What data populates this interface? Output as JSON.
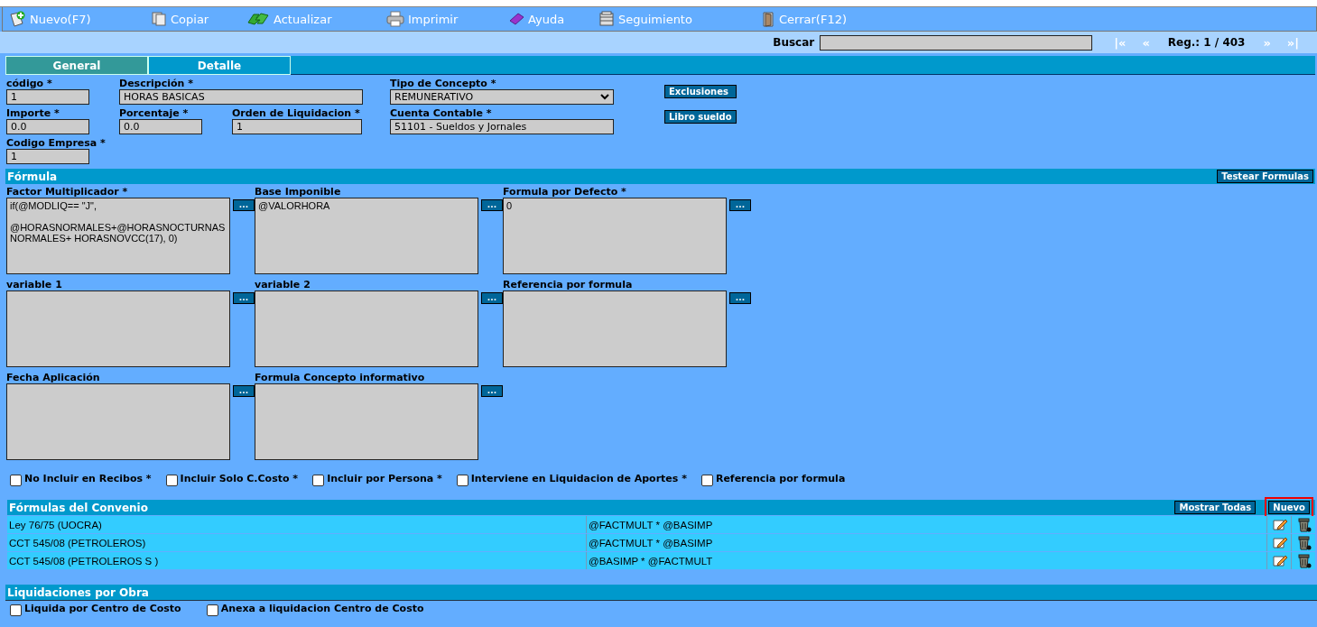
{
  "toolbar": [
    {
      "label": "Nuevo(F7)"
    },
    {
      "label": "Copiar"
    },
    {
      "label": "Actualizar"
    },
    {
      "label": "Imprimir"
    },
    {
      "label": "Ayuda"
    },
    {
      "label": "Seguimiento"
    },
    {
      "label": "Cerrar(F12)"
    }
  ],
  "search": {
    "label": "Buscar",
    "first": "|«",
    "prev": "«",
    "record": "Reg.: 1 / 403",
    "next": "»",
    "last": "»|"
  },
  "tabs": [
    {
      "label": "General",
      "selected": true
    },
    {
      "label": "Detalle",
      "selected": false
    }
  ],
  "field_rows": [
    [
      {
        "label": "código *",
        "value": "1",
        "kind": "input"
      },
      {
        "label": "Descripción *",
        "value": "HORAS BASICAS",
        "kind": "input"
      },
      {
        "label": "Tipo de Concepto *",
        "value": "REMUNERATIVO",
        "kind": "select"
      }
    ],
    [
      {
        "label": "Importe *",
        "value": "0.0",
        "kind": "input"
      },
      {
        "label": "Porcentaje *",
        "value": "0.0",
        "kind": "input"
      },
      {
        "label": "Orden de Liquidacion *",
        "value": "1",
        "kind": "input"
      },
      {
        "label": "Cuenta Contable *",
        "value": "51101 - Sueldos y Jornales",
        "kind": "input"
      }
    ],
    [
      {
        "label": "Codigo Empresa *",
        "value": "1",
        "kind": "input"
      }
    ]
  ],
  "side_buttons": [
    "Exclusiones",
    "Libro sueldo"
  ],
  "formula": {
    "title": "Fórmula",
    "button": "Testear Formulas",
    "fields": [
      {
        "label": "Factor Multiplicador *",
        "value": "if(@MODLIQ== \"J\",\n\n@HORASNORMALES+@HORASNOCTURNASNORMALES+ HORASNOVCC(17), 0)",
        "button": "..."
      },
      {
        "label": "Base Imponible",
        "value": "@VALORHORA",
        "button": "..."
      },
      {
        "label": "Formula por Defecto *",
        "value": "0",
        "button": "..."
      },
      {
        "label": "variable 1",
        "button": "..."
      },
      {
        "label": "variable 2",
        "button": "..."
      },
      {
        "label": "Referencia por formula",
        "button": "..."
      },
      {
        "label": "Fecha Aplicación",
        "button": "..."
      },
      {
        "label": "Formula Concepto informativo",
        "button": "..."
      }
    ]
  },
  "checkboxes": [
    {
      "label": "No Incluir en Recibos *",
      "checked": false
    },
    {
      "label": "Incluir Solo C.Costo *",
      "checked": false
    },
    {
      "label": "Incluir por Persona *",
      "checked": false
    },
    {
      "label": "Interviene en Liquidacion de Aportes *",
      "checked": false
    },
    {
      "label": "Referencia por formula",
      "checked": false
    }
  ],
  "convenio": {
    "title": "Fórmulas del Convenio",
    "buttons": [
      {
        "label": "Mostrar Todas",
        "highlighted": false
      },
      {
        "label": "Nuevo",
        "highlighted": true
      }
    ],
    "rows": [
      {
        "name": "Ley 76/75 (UOCRA)",
        "formula": "@FACTMULT * @BASIMP"
      },
      {
        "name": "CCT 545/08 (PETROLEROS)",
        "formula": "@FACTMULT * @BASIMP"
      },
      {
        "name": "CCT 545/08 (PETROLEROS S )",
        "formula": "@BASIMP * @FACTMULT"
      }
    ]
  },
  "obra": {
    "title": "Liquidaciones por Obra",
    "checkboxes": [
      {
        "label": "Liquida por Centro de Costo",
        "checked": false
      },
      {
        "label": "Anexa a liquidacion Centro de Costo",
        "checked": false
      }
    ]
  }
}
